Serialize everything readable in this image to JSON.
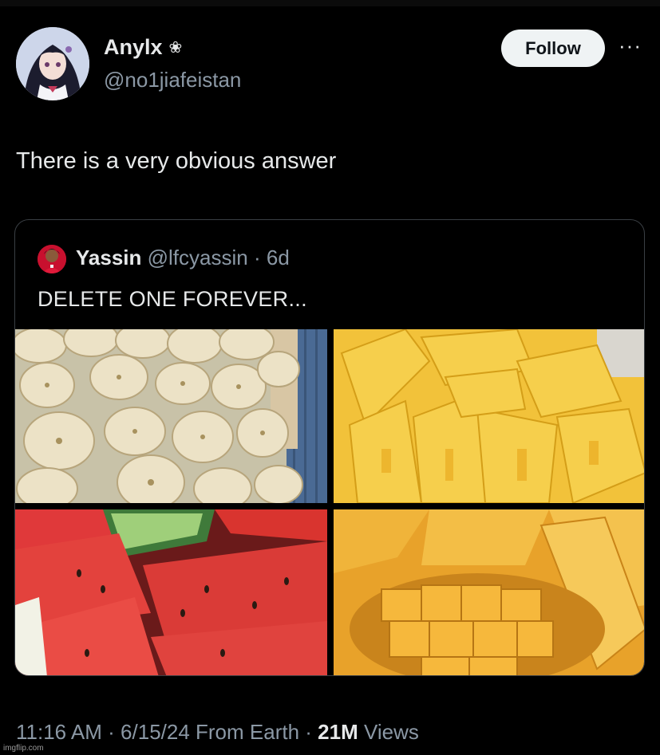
{
  "author": {
    "display_name": "Anylx",
    "name_symbol": "❀",
    "handle": "@no1jiafeistan"
  },
  "actions": {
    "follow_label": "Follow",
    "more_label": "···"
  },
  "tweet": {
    "text": "There is a very obvious answer"
  },
  "quoted": {
    "name": "Yassin",
    "handle": "@lfcyassin",
    "separator": "·",
    "age": "6d",
    "text": "DELETE ONE FOREVER..."
  },
  "meta": {
    "time": "11:16 AM",
    "sep1": " · ",
    "date": "6/15/24",
    "source": " From Earth",
    "sep2": " · ",
    "views_count": "21M",
    "views_label": " Views"
  },
  "watermark": "imgflip.com",
  "colors": {
    "background": "#000000",
    "text_primary": "#e7e9ea",
    "text_secondary": "#8b98a5",
    "follow_bg": "#eff3f4",
    "card_border": "#3a3f44"
  }
}
